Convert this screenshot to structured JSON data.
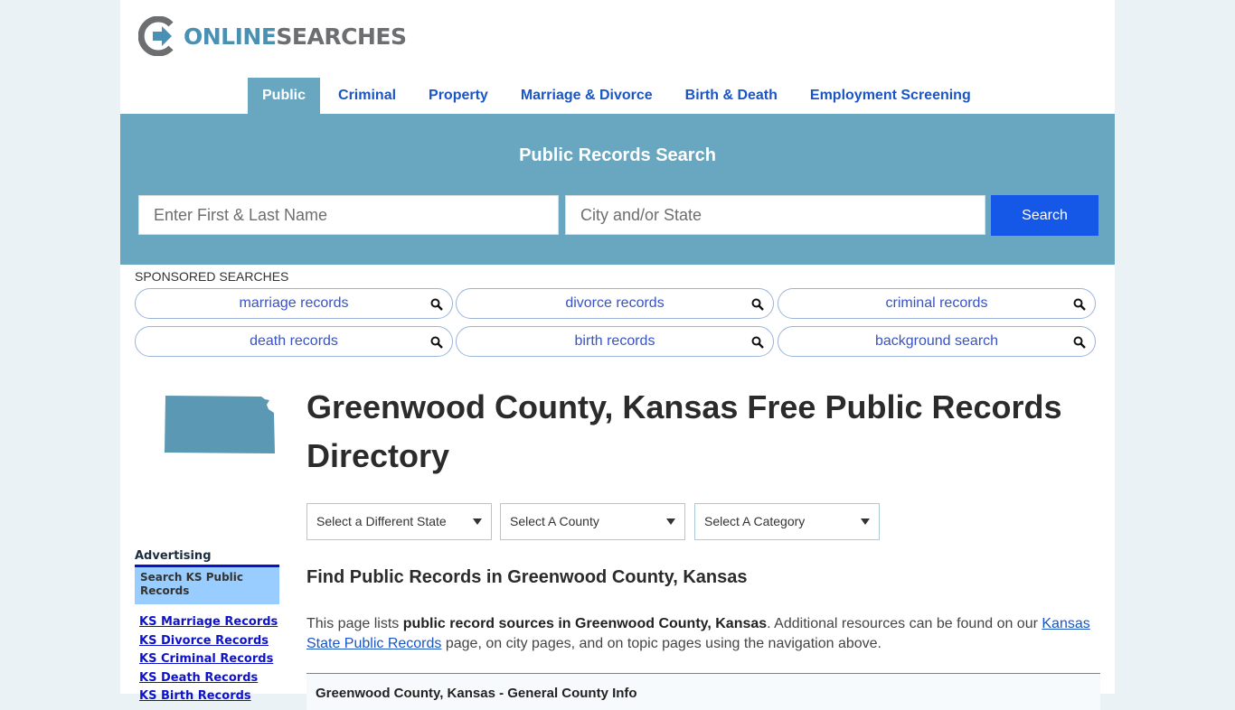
{
  "logo": {
    "brand_part1": "ONLINE",
    "brand_part2": "SEARCHES"
  },
  "nav": {
    "items": [
      {
        "label": "Public",
        "active": true
      },
      {
        "label": "Criminal"
      },
      {
        "label": "Property"
      },
      {
        "label": "Marriage & Divorce"
      },
      {
        "label": "Birth & Death"
      },
      {
        "label": "Employment Screening"
      }
    ]
  },
  "search": {
    "title": "Public Records Search",
    "name_placeholder": "Enter First & Last Name",
    "location_placeholder": "City and/or State",
    "button_label": "Search"
  },
  "sponsored": {
    "label": "SPONSORED SEARCHES",
    "items": [
      {
        "label": "marriage records"
      },
      {
        "label": "divorce records"
      },
      {
        "label": "criminal records"
      },
      {
        "label": "death records"
      },
      {
        "label": "birth records"
      },
      {
        "label": "background search"
      }
    ]
  },
  "page": {
    "title": "Greenwood County, Kansas Free Public Records Directory",
    "selects": [
      {
        "label": "Select a Different State"
      },
      {
        "label": "Select A County"
      },
      {
        "label": "Select A Category"
      }
    ],
    "find_heading": "Find Public Records in Greenwood County, Kansas",
    "intro": {
      "part1": "This page lists ",
      "bold": "public record sources in Greenwood County, Kansas",
      "part2": ". Additional resources can be found on our ",
      "link": "Kansas State Public Records",
      "part3": " page, on city pages, and on topic pages using the navigation above."
    },
    "info_box_title": "Greenwood County, Kansas - General County Info"
  },
  "sidebar": {
    "ad_label": "Advertising",
    "ad_box": "Search KS Public Records",
    "links": [
      "KS Marriage Records",
      "KS Divorce Records",
      "KS Criminal Records",
      "KS Death Records",
      "KS Birth Records"
    ]
  },
  "colors": {
    "brand_blue": "#4a90b4",
    "hero_bg": "#69a7c0",
    "button_blue": "#1557e6",
    "link_blue": "#1a55c4"
  }
}
